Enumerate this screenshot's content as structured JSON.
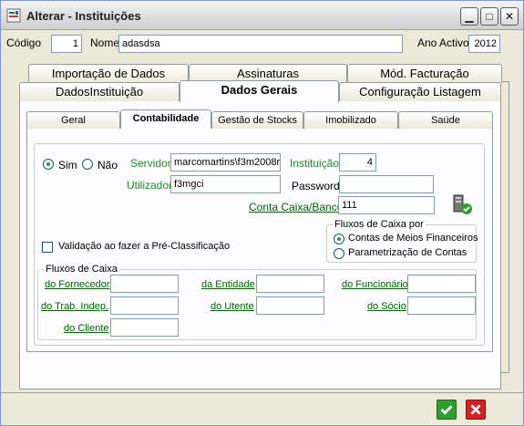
{
  "window": {
    "title": "Alterar - Instituições"
  },
  "header": {
    "codigo_label": "Código",
    "codigo_value": "1",
    "nome_label": "Nome",
    "nome_value": "adasdsa",
    "ano_label": "Ano Activo",
    "ano_value": "2012"
  },
  "tabs_row1": [
    "Importação de Dados",
    "Assinaturas",
    "Mód. Facturação"
  ],
  "tabs_row2": [
    "DadosInstituição",
    "Dados Gerais",
    "Configuração Listagem"
  ],
  "subtabs": [
    "Geral",
    "Contabilidade",
    "Gestão de Stocks",
    "Imobilizado",
    "Saúde"
  ],
  "contab": {
    "sim_label": "Sim",
    "nao_label": "Não",
    "servidor_label": "Servidor",
    "servidor_value": "marcomartins\\f3m2008r",
    "instituicao_label": "Instituição",
    "instituicao_value": "4",
    "utilizador_label": "Utilizador",
    "utilizador_value": "f3mgci",
    "password_label": "Password",
    "password_value": "",
    "conta_label": "Conta Caixa/Banco",
    "conta_value": "111",
    "fluxos_por_title": "Fluxos de Caixa por",
    "opt1": "Contas de Meios Financeiros",
    "opt2": "Parametrização de Contas",
    "validacao_label": "Validação ao fazer a Pré-Classificação",
    "fluxos_title": "Fluxos de Caixa",
    "do_fornecedor": "do Fornecedor",
    "da_entidade": "da Entidade",
    "do_funcionario": "do Funcionário",
    "do_trab": "do Trab. Indep.",
    "do_utente": "do Utente",
    "do_socio": "do Sócio",
    "do_cliente": "do Cliente"
  },
  "colors": {
    "accent_green": "#228b22",
    "ok": "#2e9e2e",
    "cancel": "#d42020"
  }
}
